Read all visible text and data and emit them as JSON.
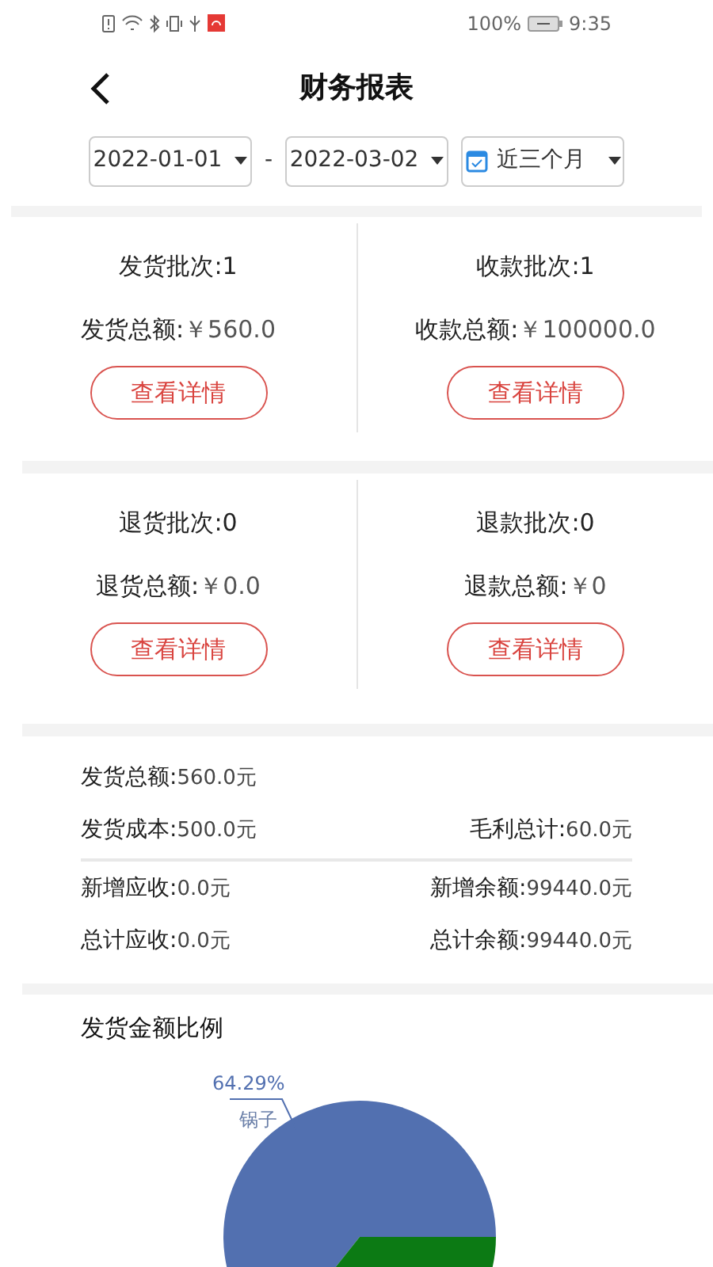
{
  "status_bar": {
    "battery": "100%",
    "time": "9:35"
  },
  "header": {
    "title": "财务报表"
  },
  "filters": {
    "start_date": "2022-01-01",
    "separator": "-",
    "end_date": "2022-03-02",
    "range": "近三个月"
  },
  "summary_cards": [
    {
      "cells": [
        {
          "count_label": "发货批次:1",
          "amount_label": "发货总额:",
          "amount": "￥560.0",
          "button": "查看详情"
        },
        {
          "count_label": "收款批次:1",
          "amount_label": "收款总额:",
          "amount": "￥100000.0",
          "button": "查看详情"
        }
      ]
    },
    {
      "cells": [
        {
          "count_label": "退货批次:0",
          "amount_label": "退货总额:",
          "amount": "￥0.0",
          "button": "查看详情"
        },
        {
          "count_label": "退款批次:0",
          "amount_label": "退款总额:",
          "amount": "￥0",
          "button": "查看详情"
        }
      ]
    }
  ],
  "totals": [
    {
      "left": {
        "label": "发货总额:",
        "value": "560.0元"
      }
    },
    {
      "left": {
        "label": "发货成本:",
        "value": "500.0元"
      },
      "right": {
        "label": "毛利总计:",
        "value": "60.0元"
      },
      "divider_after": true
    },
    {
      "left": {
        "label": "新增应收:",
        "value": "0.0元"
      },
      "right": {
        "label": "新增余额:",
        "value": "99440.0元"
      }
    },
    {
      "left": {
        "label": "总计应收:",
        "value": "0.0元"
      },
      "right": {
        "label": "总计余额:",
        "value": "99440.0元"
      }
    }
  ],
  "chart": {
    "chart_data": {
      "type": "pie",
      "title": "发货金额比例",
      "categories": [
        "锅子",
        null
      ],
      "values": [
        64.29,
        35.71
      ],
      "colors": [
        "#5270b0",
        "#0c7a14"
      ],
      "value_labels": [
        "64.29%",
        null
      ]
    }
  }
}
